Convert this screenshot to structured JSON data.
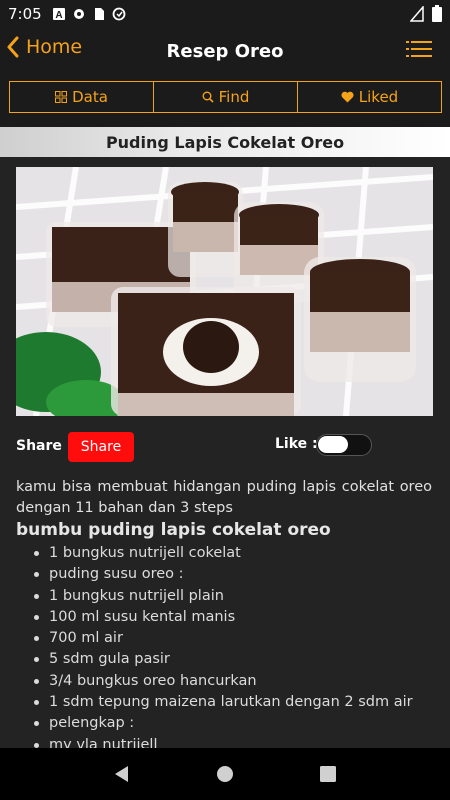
{
  "status_bar": {
    "time": "7:05",
    "icons": [
      "autofill-icon",
      "settings-gear-icon",
      "sd-card-icon",
      "data-saver-icon"
    ],
    "right_icons": [
      "signal-icon",
      "battery-icon"
    ]
  },
  "app_bar": {
    "back_label": "Home",
    "title": "Resep Oreo",
    "menu_icon": "hamburger-list-icon"
  },
  "tabs": [
    {
      "label": "Data",
      "icon": "grid-icon"
    },
    {
      "label": "Find",
      "icon": "search-icon"
    },
    {
      "label": "Liked",
      "icon": "heart-icon"
    }
  ],
  "recipe": {
    "title": "Puding Lapis Cokelat Oreo",
    "share_label": "Share :",
    "share_button": "Share",
    "like_label": "Like :",
    "like_on": false,
    "description": "kamu bisa membuat hidangan puding lapis cokelat oreo dengan 11 bahan dan 3 steps",
    "section_title": "bumbu puding lapis cokelat oreo",
    "ingredients": [
      "1 bungkus nutrijell cokelat",
      "puding susu oreo :",
      "1 bungkus nutrijell plain",
      "100 ml susu kental manis",
      "700 ml air",
      "5 sdm gula pasir",
      "3/4 bungkus oreo hancurkan",
      "1 sdm tepung maizena larutkan dengan 2 sdm air",
      "pelengkap :",
      "my vla nutrijell"
    ]
  },
  "colors": {
    "accent": "#f5a21b",
    "background": "#1b1b1b",
    "share_button": "#ff0d0d"
  },
  "nav_bar": {
    "buttons": [
      "back-triangle-icon",
      "home-circle-icon",
      "recents-square-icon"
    ]
  }
}
